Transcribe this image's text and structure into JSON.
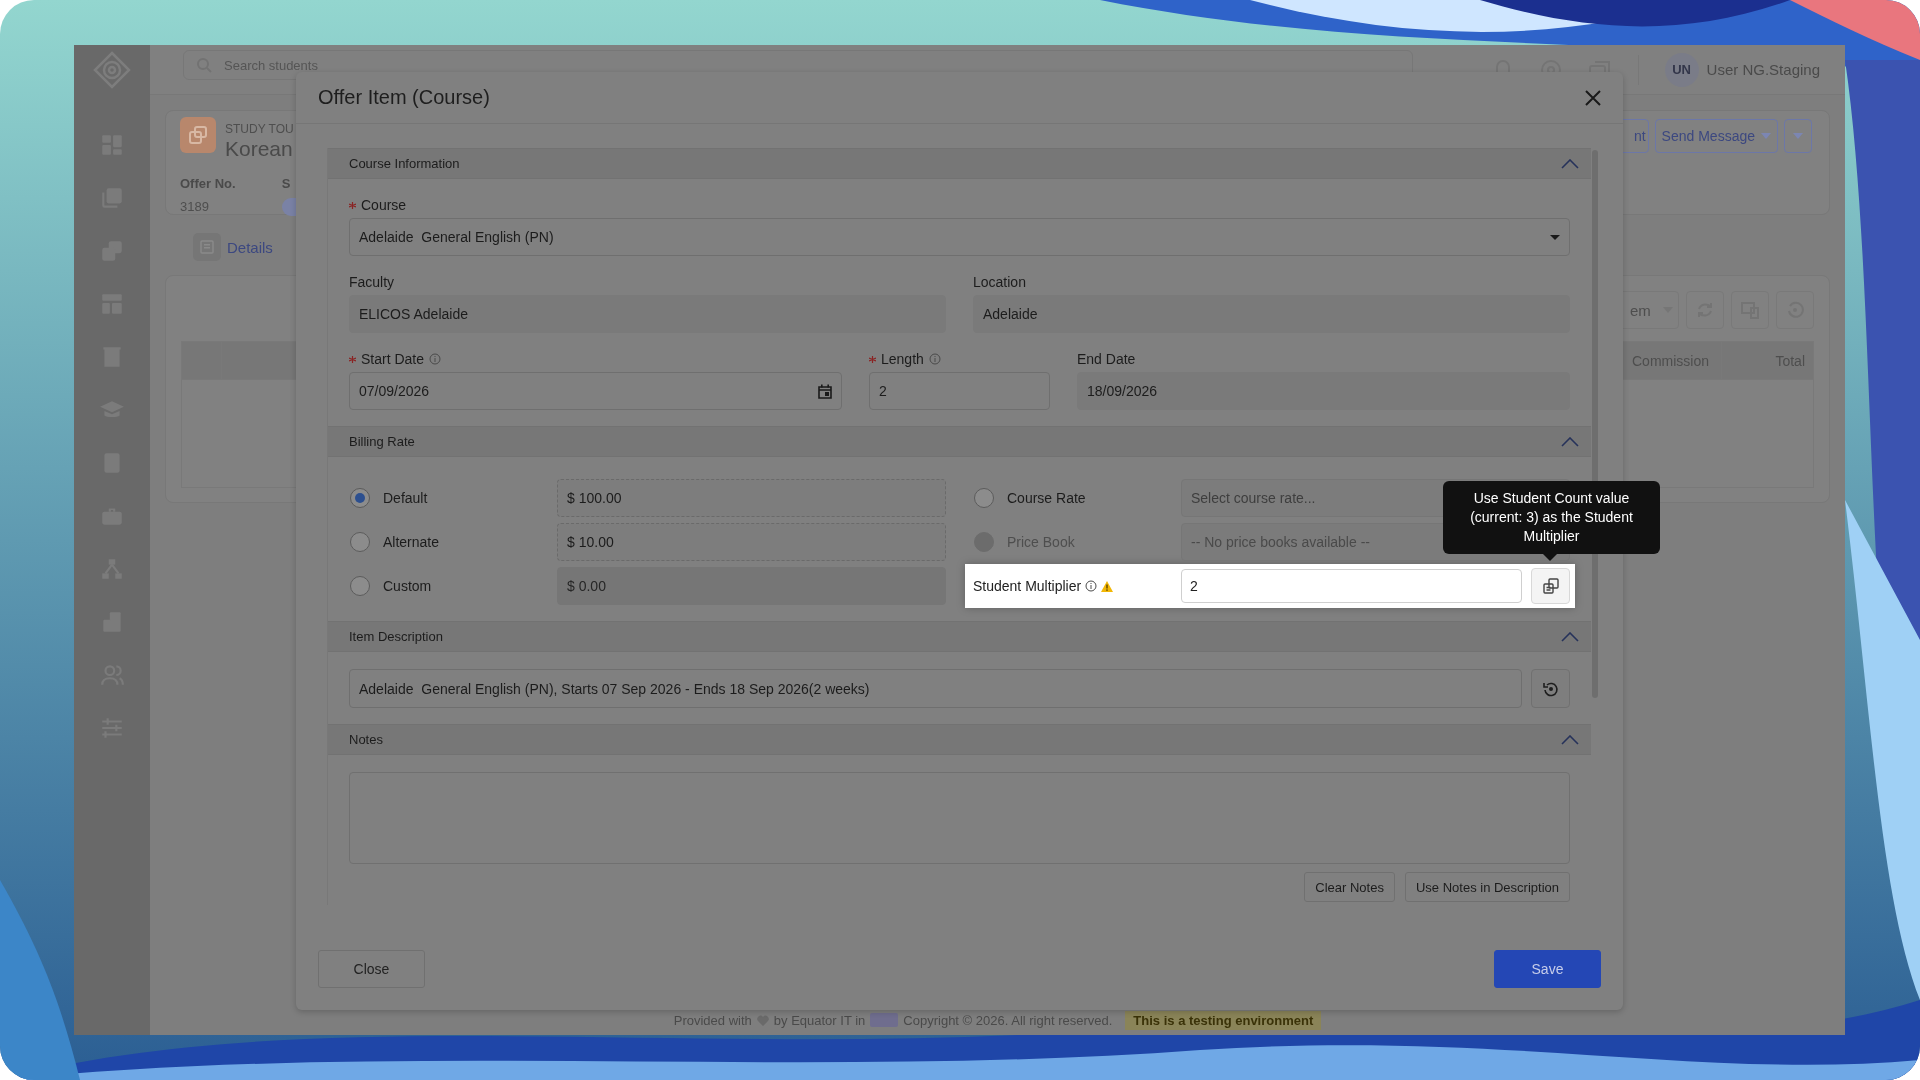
{
  "app": {
    "search": {
      "placeholder": "Search students"
    },
    "user": {
      "initials": "UN",
      "name": "User NG.Staging"
    },
    "record": {
      "type": "STUDY TOU",
      "title": "Korean",
      "offer_label": "Offer No.",
      "offer_number": "3189",
      "status_label": "S"
    },
    "actions": [
      {
        "label": "nt",
        "dropdown": false
      },
      {
        "label": "Send Message",
        "dropdown": true
      }
    ],
    "tabs": [
      {
        "label": "Details",
        "selected": true
      }
    ],
    "table": {
      "view": "em",
      "columns": [
        "Commission",
        "Total"
      ]
    },
    "footer": {
      "text": "Provided with",
      "credit": "by Equator IT in",
      "copyright": "Copyright © 2026. All right reserved.",
      "badge": "This is a testing environment"
    }
  },
  "modal": {
    "title": "Offer Item (Course)",
    "sections": [
      {
        "kind": "course",
        "title": "Course Information",
        "expanded": true,
        "course": {
          "label": "Course",
          "required": true,
          "value": "Adelaide  General English (PN)"
        },
        "faculty": {
          "label": "Faculty",
          "required": false,
          "value": "ELICOS Adelaide"
        },
        "location": {
          "label": "Location",
          "required": false,
          "value": "Adelaide"
        },
        "start_date": {
          "label": "Start Date",
          "required": true,
          "info": true,
          "value": "07/09/2026"
        },
        "length": {
          "label": "Length",
          "required": true,
          "info": true,
          "value": "2"
        },
        "end_date": {
          "label": "End Date",
          "required": false,
          "value": "18/09/2026"
        }
      },
      {
        "kind": "billing",
        "title": "Billing Rate",
        "expanded": true,
        "rates": [
          {
            "label": "Default",
            "selected": true,
            "amount": "$ 100.00",
            "kind": "readonly"
          },
          {
            "label": "Alternate",
            "selected": false,
            "amount": "$ 10.00",
            "kind": "readonly"
          },
          {
            "label": "Custom",
            "selected": false,
            "amount": "$ 0.00",
            "kind": "disabled"
          }
        ],
        "sources": [
          {
            "label": "Course Rate",
            "selected": false,
            "disabled": false,
            "placeholder": "Select course rate..."
          },
          {
            "label": "Price Book",
            "selected": false,
            "disabled": true,
            "placeholder": "-- No price books available --"
          }
        ],
        "multiplier": {
          "label": "Student Multiplier",
          "info": true,
          "warning": true,
          "value": "2"
        }
      },
      {
        "kind": "description",
        "title": "Item Description",
        "expanded": true,
        "value": "Adelaide  General English (PN), Starts 07 Sep 2026 - Ends 18 Sep 2026(2 weeks)"
      },
      {
        "kind": "notes",
        "title": "Notes",
        "expanded": true,
        "buttons": [
          "Clear Notes",
          "Use Notes in Description"
        ]
      }
    ],
    "buttons": [
      {
        "label": "Close",
        "kind": "secondary"
      },
      {
        "label": "Save",
        "kind": "primary"
      }
    ]
  },
  "tooltip": {
    "text": "Use Student Count value (current: 3) as the Student Multiplier"
  }
}
